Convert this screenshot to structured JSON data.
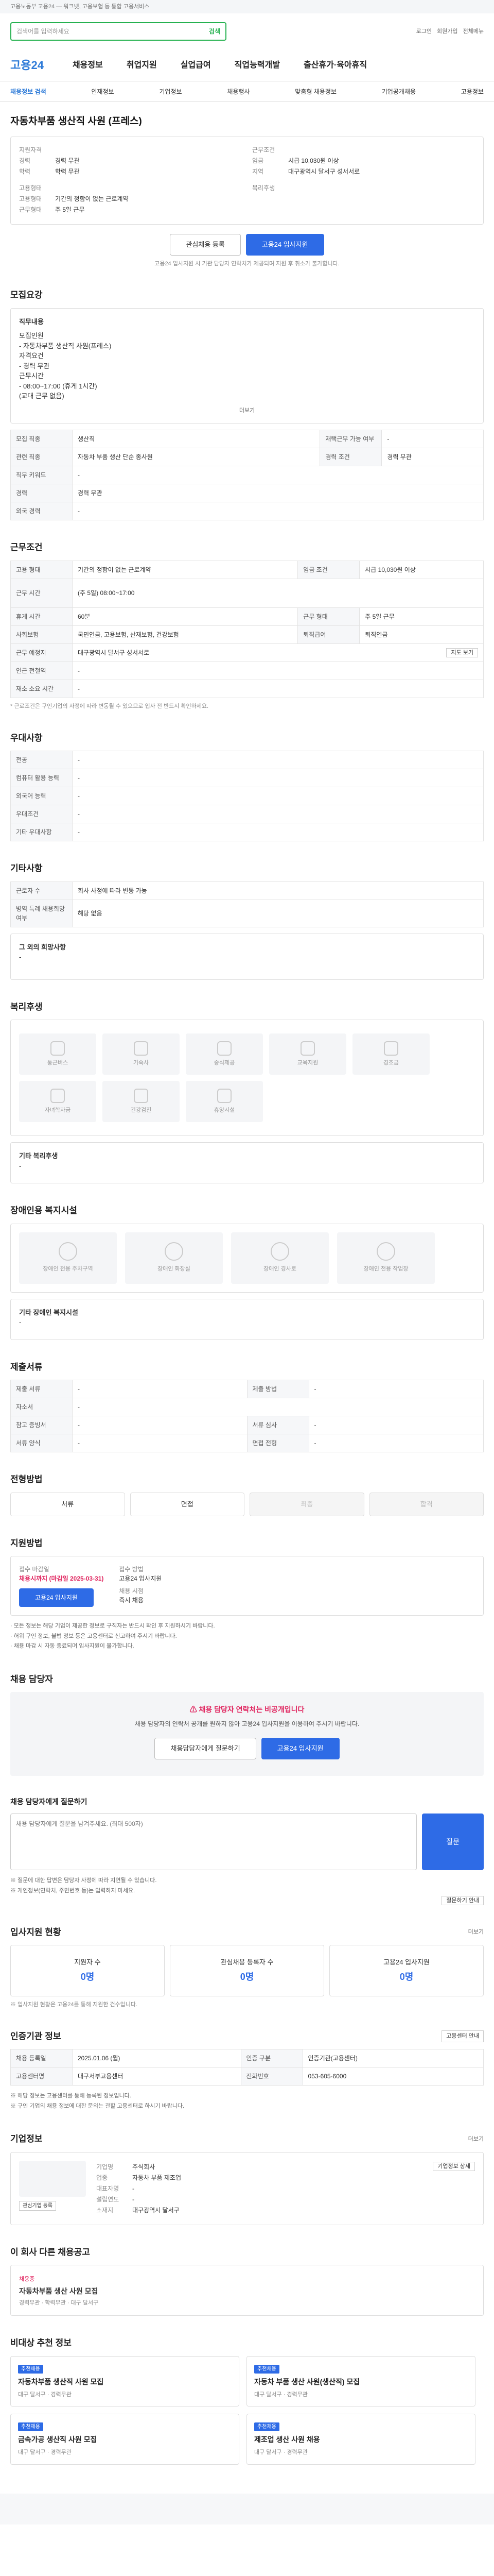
{
  "top_banner": "고용노동부 고용24 — 워크넷, 고용보험 등 통합 고용서비스",
  "search": {
    "placeholder": "검색어를 입력하세요",
    "button": "검색"
  },
  "util": [
    "로그인",
    "회원가입",
    "전체메뉴"
  ],
  "gnb": {
    "logo": "고용24",
    "items": [
      "채용정보",
      "취업지원",
      "실업급여",
      "직업능력개발",
      "출산휴가·육아휴직"
    ]
  },
  "lnb": [
    "채용정보 검색",
    "인재정보",
    "기업정보",
    "채용행사",
    "맞춤형 채용정보",
    "기업공개채용",
    "고용정보"
  ],
  "job": {
    "title": "자동차부품 생산직 사원 (프레스)",
    "left": {
      "heading": "지원자격",
      "rows": [
        {
          "k": "경력",
          "v": "경력 무관"
        },
        {
          "k": "학력",
          "v": "학력 무관"
        }
      ],
      "heading2": "고용형태",
      "rows2": [
        {
          "k": "고용형태",
          "v": "기간의 정함이 없는 근로계약"
        },
        {
          "k": "근무형태",
          "v": "주 5일 근무"
        }
      ]
    },
    "right": {
      "heading": "근무조건",
      "rows": [
        {
          "k": "임금",
          "v": "시급 10,030원 이상"
        },
        {
          "k": "지역",
          "v": "대구광역시 달서구 성서서로"
        }
      ],
      "heading2": "복리후생",
      "rows2": []
    },
    "buttons": {
      "scrap": "관심채용 등록",
      "apply": "고용24 입사지원"
    },
    "notice": "고용24 입사지원 시 기관 담당자 연락처가 제공되며 지원 후 취소가 불가합니다."
  },
  "duty": {
    "title": "모집요강",
    "content_title": "직무내용",
    "lines": [
      "모집인원",
      "- 자동차부품 생산직 사원(프레스)",
      "자격요건",
      "- 경력 무관",
      "근무시간",
      "- 08:00~17:00 (휴게 1시간)",
      "(교대 근무 없음)"
    ],
    "more": "더보기",
    "rows": [
      [
        "모집 직종",
        "생산직",
        "재택근무 가능 여부",
        "-"
      ],
      [
        "관련 직종",
        "자동차 부품 생산 단순 종사원",
        "경력 조건",
        "경력 무관"
      ],
      [
        "직무 키워드",
        "-",
        "",
        ""
      ],
      [
        "경력",
        "경력 무관",
        "",
        ""
      ],
      [
        "외국 경력",
        "-",
        "",
        ""
      ]
    ]
  },
  "cond": {
    "title": "근무조건",
    "rows": [
      [
        "고용 형태",
        "기간의 정함이 없는 근로계약",
        "임금 조건",
        "시급 10,030원 이상"
      ],
      [
        "근무 시간",
        "(주 5일) 08:00~17:00",
        "",
        ""
      ],
      [
        "휴게 시간",
        "60분",
        "근무 형태",
        "주 5일 근무"
      ],
      [
        "사회보험",
        "국민연금, 고용보험, 산재보험, 건강보험",
        "퇴직급여",
        "퇴직연금"
      ],
      [
        "근무 예정지",
        "대구광역시 달서구 성서서로",
        "",
        ""
      ],
      [
        "인근 전철역",
        "-",
        "",
        ""
      ],
      [
        "재소 소요 시간",
        "-",
        "",
        ""
      ]
    ],
    "map_btn": "지도 보기",
    "note": "* 근로조건은 구인기업의 사정에 따라 변동될 수 있으므로 입사 전 반드시 확인하세요."
  },
  "pref": {
    "title": "우대사항",
    "rows": [
      [
        "전공",
        "-"
      ],
      [
        "컴퓨터 활용 능력",
        "-"
      ],
      [
        "외국어 능력",
        "-"
      ],
      [
        "우대조건",
        "-"
      ],
      [
        "기타 우대사항",
        "-"
      ]
    ]
  },
  "etc": {
    "title": "기타사항",
    "rows": [
      [
        "근로자 수",
        "회사 사정에 따라 변동 가능"
      ],
      [
        "병역 특례 채용희망 여부",
        "해당 없음"
      ]
    ],
    "extra_title": "그 외의 희망사항",
    "extra": "-"
  },
  "welfare": {
    "title": "복리후생",
    "items": [
      "통근버스",
      "기숙사",
      "중식제공",
      "교육지원",
      "경조금",
      "자녀학자금",
      "건강검진",
      "휴양시설"
    ],
    "etc_title": "기타 복리후생",
    "etc": "-"
  },
  "disability": {
    "title": "장애인용 복지시설",
    "items": [
      "장애인 전용 주차구역",
      "장애인 화장실",
      "장애인 경사로",
      "장애인 전용 작업장"
    ],
    "etc_title": "기타 장애인 복지시설",
    "etc": "-"
  },
  "doc": {
    "title": "제출서류",
    "rows": [
      [
        "제출 서류",
        "-",
        "제출 방법",
        "-"
      ],
      [
        "자소서",
        "-",
        "",
        ""
      ],
      [
        "참고 증빙서",
        "-",
        "서류 심사",
        "-"
      ],
      [
        "서류 양식",
        "-",
        "면접 전형",
        "-"
      ]
    ]
  },
  "process": {
    "title": "전형방법",
    "steps": [
      "서류",
      "면접",
      "최종",
      "합격"
    ]
  },
  "apply": {
    "title": "지원방법",
    "period_label": "접수 마감일",
    "period": "채용시까지 (마감일 2025-03-31)",
    "method_label": "접수 방법",
    "method": "고용24 입사지원",
    "result_label": "채용 시점",
    "result": "즉시 채용",
    "btn": "고용24 입사지원",
    "bullets": [
      "· 모든 정보는 해당 기업이 제공한 정보로 구직자는 반드시 확인 후 지원하시기 바랍니다.",
      "· 허위 구인 정보, 불법 정보 등은 고용센터로 신고하여 주시기 바랍니다.",
      "· 채용 마감 시 자동 종료되며 입사지원이 불가합니다."
    ]
  },
  "manager": {
    "title": "채용 담당자",
    "warn": "채용 담당자 연락처는 비공개입니다",
    "desc": "채용 담당자의 연락처 공개를 원하지 않아 고용24 입사지원을 이용하여 주시기 바랍니다.",
    "btn1": "채용담당자에게 질문하기",
    "btn2": "고용24 입사지원"
  },
  "qa": {
    "title": "채용 담당자에게 질문하기",
    "placeholder": "채용 담당자에게 질문을 남겨주세요. (최대 500자)",
    "btn": "질문",
    "notes": [
      "※ 질문에 대한 답변은 담당자 사정에 따라 지연될 수 있습니다.",
      "※ 개인정보(연락처, 주민번호 등)는 입력하지 마세요."
    ],
    "more": "질문하기 안내"
  },
  "status": {
    "title": "입사지원 현황",
    "more": "더보기",
    "items": [
      {
        "label": "지원자 수",
        "n": "0명"
      },
      {
        "label": "관심채용 등록자 수",
        "n": "0명"
      },
      {
        "label": "고용24 입사지원",
        "n": "0명"
      }
    ],
    "note": "※ 입사지원 현황은 고용24를 통해 지원한 건수입니다."
  },
  "recruit": {
    "title": "인증기관 정보",
    "btn": "고용센터 안내",
    "rows": [
      [
        "채용 등록일",
        "2025.01.06 (월)",
        "인증 구분",
        "인증기관(고용센터)"
      ],
      [
        "고용센터명",
        "대구서부고용센터",
        "전화번호",
        "053-605-6000"
      ]
    ],
    "notes": [
      "※ 해당 정보는 고용센터를 통해 등록된 정보입니다.",
      "※ 구인 기업의 채용 정보에 대한 문의는 관할 고용센터로 하시기 바랍니다."
    ]
  },
  "company": {
    "title": "기업정보",
    "more": "더보기",
    "rows": [
      [
        "기업명",
        "주식회사"
      ],
      [
        "업종",
        "자동차 부품 제조업"
      ],
      [
        "대표자명",
        "-"
      ],
      [
        "설립연도",
        "-"
      ],
      [
        "소재지",
        "대구광역시 달서구"
      ]
    ],
    "btn": "관심기업 등록",
    "btn2": "기업정보 상세"
  },
  "similar": {
    "title": "이 회사 다른 채용공고",
    "badge": "채용중",
    "t": "자동차부품 생산 사원 모집",
    "meta": [
      "경력무관",
      "학력무관",
      "대구 달서구"
    ]
  },
  "recommend": {
    "title": "비대상 추천 정보",
    "cards": [
      {
        "badge": "추천채용",
        "t": "자동차부품 생산직 사원 모집",
        "meta": "대구 달서구 · 경력무관"
      },
      {
        "badge": "추천채용",
        "t": "자동차 부품 생산 사원(생산직) 모집",
        "meta": "대구 달서구 · 경력무관"
      },
      {
        "badge": "추천채용",
        "t": "금속가공 생산직 사원 모집",
        "meta": "대구 달서구 · 경력무관"
      },
      {
        "badge": "추천채용",
        "t": "제조업 생산 사원 채용",
        "meta": "대구 달서구 · 경력무관"
      }
    ]
  }
}
